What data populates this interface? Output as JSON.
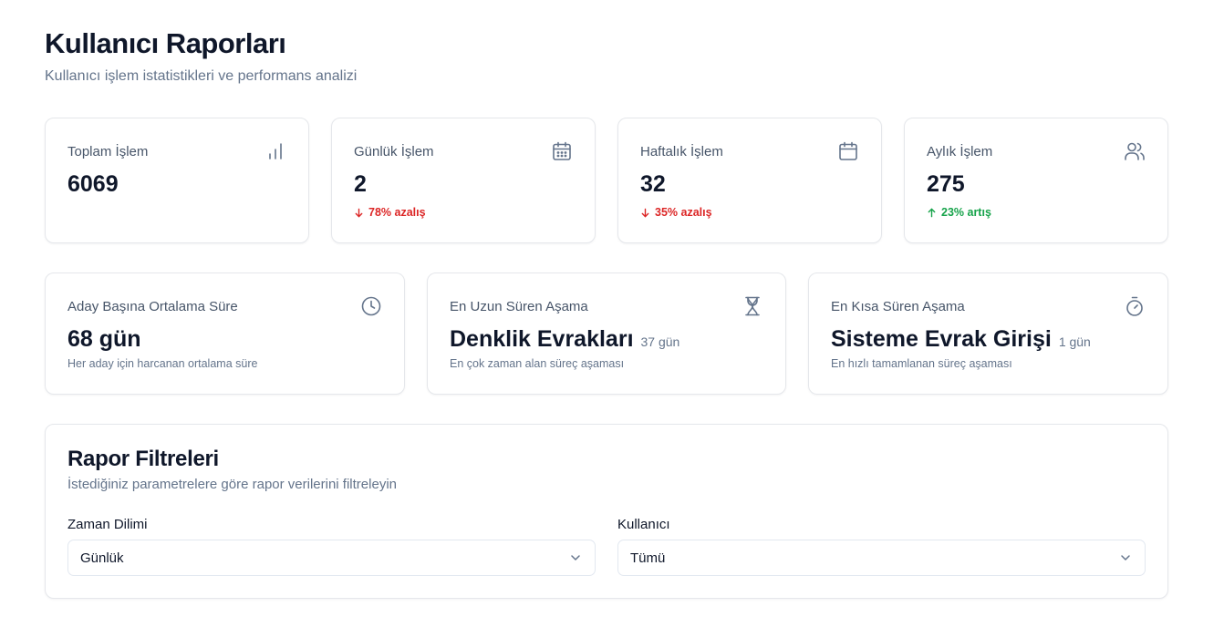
{
  "header": {
    "title": "Kullanıcı Raporları",
    "subtitle": "Kullanıcı işlem istatistikleri ve performans analizi"
  },
  "stats": [
    {
      "label": "Toplam İşlem",
      "value": "6069",
      "icon": "bar-chart-icon"
    },
    {
      "label": "Günlük İşlem",
      "value": "2",
      "trend": "78% azalış",
      "trend_direction": "down",
      "icon": "calendar-days-icon"
    },
    {
      "label": "Haftalık İşlem",
      "value": "32",
      "trend": "35% azalış",
      "trend_direction": "down",
      "icon": "calendar-icon"
    },
    {
      "label": "Aylık İşlem",
      "value": "275",
      "trend": "23% artış",
      "trend_direction": "up",
      "icon": "users-icon"
    }
  ],
  "details": [
    {
      "label": "Aday Başına Ortalama Süre",
      "value": "68 gün",
      "suffix": "",
      "description": "Her aday için harcanan ortalama süre",
      "icon": "clock-icon"
    },
    {
      "label": "En Uzun Süren Aşama",
      "value": "Denklik Evrakları",
      "suffix": "37 gün",
      "description": "En çok zaman alan süreç aşaması",
      "icon": "hourglass-icon"
    },
    {
      "label": "En Kısa Süren Aşama",
      "value": "Sisteme Evrak Girişi",
      "suffix": "1 gün",
      "description": "En hızlı tamamlanan süreç aşaması",
      "icon": "timer-icon"
    }
  ],
  "filters": {
    "title": "Rapor Filtreleri",
    "description": "İstediğiniz parametrelere göre rapor verilerini filtreleyin",
    "time_range": {
      "label": "Zaman Dilimi",
      "value": "Günlük"
    },
    "user": {
      "label": "Kullanıcı",
      "value": "Tümü"
    }
  },
  "colors": {
    "decrease": "#dc2626",
    "increase": "#16a34a",
    "muted": "#64748b",
    "border": "#e5e7eb"
  }
}
